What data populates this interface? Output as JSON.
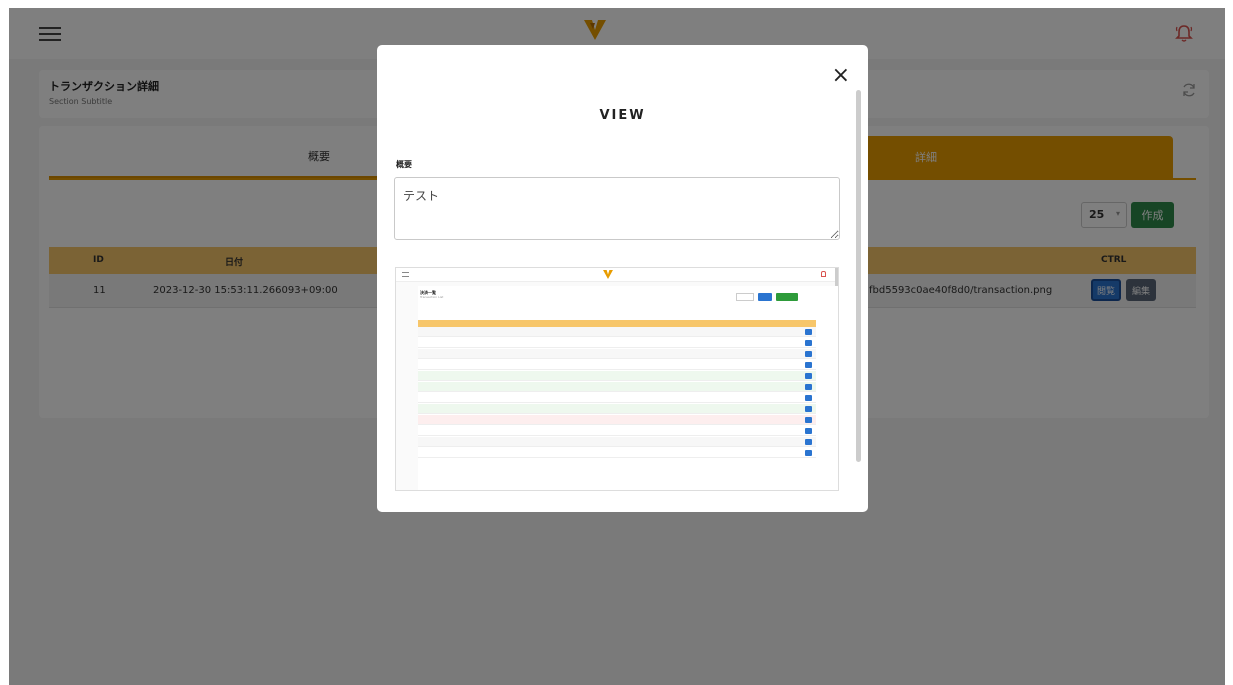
{
  "header": {
    "menu_icon": "hamburger-icon",
    "logo_icon": "brand-logo",
    "bell_icon": "bell-icon",
    "accent": "#e89c00",
    "alert": "#d9534f"
  },
  "section": {
    "title": "トランザクション詳細",
    "subtitle": "Section Subtitle",
    "refresh_icon": "refresh-icon"
  },
  "tabs": [
    {
      "label": "概要"
    },
    {
      "label": "詳細"
    }
  ],
  "toolbar": {
    "page_size": "25",
    "create_label": "作成"
  },
  "table": {
    "columns": [
      "ID",
      "日付",
      "CTRL"
    ],
    "rows": [
      {
        "id": "11",
        "date": "2023-12-30 15:53:11.266093+09:00",
        "file_fragment": "fbd5593c0ae40f8d0/transaction.png",
        "view_label": "閲覧",
        "edit_label": "編集"
      }
    ]
  },
  "modal": {
    "title": "VIEW",
    "close_label": "×",
    "field_label": "概要",
    "field_value": "テスト"
  },
  "preview": {
    "title": "決済一覧",
    "subtitle": "Transaction List",
    "status_colors": {
      "green": "#2e9b3a",
      "red": "#e03131"
    }
  }
}
